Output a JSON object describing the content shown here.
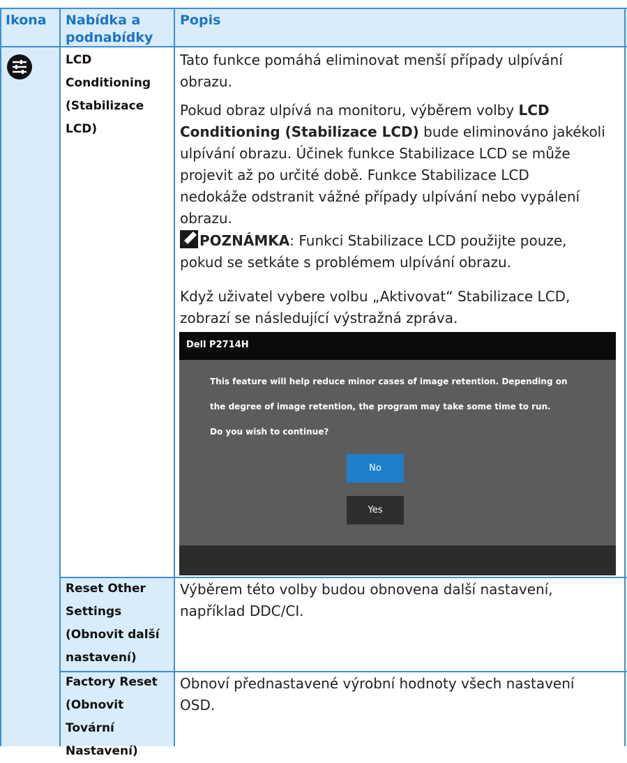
{
  "header": {
    "col_icon": "Ikona",
    "col_menu_line1": "Nabídka a",
    "col_menu_line2": "podnabídky",
    "col_desc": "Popis"
  },
  "rows": [
    {
      "icon": "sliders-icon",
      "menu_lines": [
        "LCD",
        "Conditioning",
        "(Stabilizace",
        "LCD)"
      ],
      "p1": [
        "Tato funkce pomáhá eliminovat menší případy ulpívání",
        "obrazu."
      ],
      "p2_line1_pre": "Pokud obraz ulpívá na monitoru, výběrem volby ",
      "p2_line1_bold": "LCD",
      "p2_line2_bold": "Conditioning (Stabilizace LCD)",
      "p2_line2_post": " bude eliminováno jakékoli",
      "p2_rest": [
        "ulpívání obrazu. Účinek funkce Stabilizace LCD se může",
        "projevit až po určité době. Funkce Stabilizace LCD",
        "nedokáže odstranit vážné případy ulpívání nebo vypálení",
        "obrazu."
      ],
      "note_icon": "pencil-note-icon",
      "note_bold": "POZNÁMKA",
      "note_line1": ": Funkci Stabilizace LCD použijte pouze,",
      "note_line2": "pokud se setkáte s problémem ulpívání obrazu.",
      "p3": [
        "Když uživatel vybere volbu „Aktivovat“ Stabilizace LCD,",
        "zobrazí se následující výstražná zpráva."
      ],
      "dialog": {
        "title": "Dell P2714H",
        "messages": [
          "This feature will help reduce minor cases of image retention. Depending on",
          "the degree of image retention, the program may take some time to run.",
          "Do you wish to continue?"
        ],
        "no_label": "No",
        "yes_label": "Yes"
      }
    },
    {
      "menu_lines": [
        "Reset Other",
        "Settings",
        "(Obnovit další",
        "nastavení)"
      ],
      "desc": [
        "Výběrem této volby budou obnovena další nastavení,",
        "například DDC/CI."
      ]
    },
    {
      "menu_lines": [
        "Factory Reset",
        "(Obnovit",
        "Tovární",
        "Nastavení)"
      ],
      "desc": [
        "Obnoví přednastavené výrobní hodnoty všech nastavení",
        "OSD."
      ]
    }
  ],
  "colors": {
    "border": "#3a8fd8",
    "header_bg": "#d9ecfb",
    "header_text": "#1b74c6",
    "dialog_bg": "#5c5c5c",
    "button_no": "#1f7ec8"
  }
}
